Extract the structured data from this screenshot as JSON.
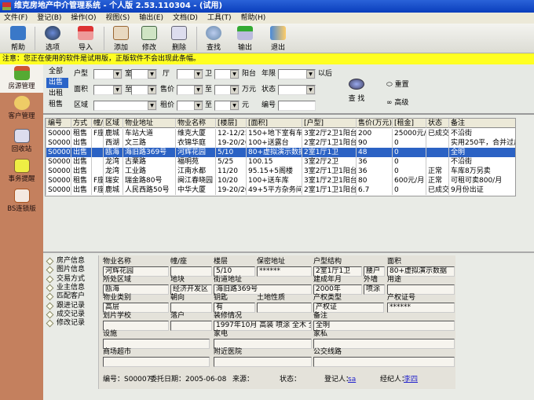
{
  "title": "维克房地产中介管理系统 - 个人版 2.53.110304 - (试用)",
  "menu": [
    "文件(F)",
    "登记(B)",
    "操作(O)",
    "视图(S)",
    "输出(E)",
    "文档(D)",
    "工具(T)",
    "帮助(H)"
  ],
  "toolbar": [
    "帮助",
    "选项",
    "导入",
    "添加",
    "修改",
    "删除",
    "查找",
    "输出",
    "退出"
  ],
  "notice": "注意：您正在使用的软件是试用版，正版软件不会出现此条幅。",
  "sidebar": [
    "房源管理",
    "客户管理",
    "回收站",
    "事务提醒",
    "BS连锁版"
  ],
  "filter": {
    "tabs": [
      "全部",
      "出售",
      "出租",
      "租售"
    ],
    "labels": {
      "huxing": "户型",
      "shi": "室",
      "ting": "厅",
      "wei": "卫",
      "yangtai": "阳台",
      "nianxian": "年限",
      "yihou": "以后",
      "mianji": "面积",
      "zhi": "至",
      "shoujia": "售价",
      "wanyuan": "万元",
      "zhuangtai": "状态",
      "quyu": "区域",
      "zujia": "租价",
      "yuan": "元",
      "bianhao": "编号"
    },
    "search": "查 找",
    "reset": "重置",
    "advanced": "高级"
  },
  "table": {
    "headers": [
      "编号",
      "方式",
      "幢/",
      "区域",
      "物业地址",
      "物业名称",
      "[楼层]",
      "[面积]",
      "[户型]",
      "售价(万元)",
      "[租金]",
      "状态",
      "备注"
    ],
    "rows": [
      [
        "S00009",
        "租售",
        "F座",
        "鹿城",
        "车站大道",
        "维克大厦",
        "12-12/25",
        "150+地下室有车位",
        "3室2厅2卫1阳台",
        "200",
        "25000元/月",
        "已成交",
        "不沿街"
      ],
      [
        "S00008",
        "出售",
        "",
        "西湖",
        "文三路",
        "衣锦华庭",
        "19-20/20",
        "100+送露台",
        "2室2厅1卫1阳台",
        "90",
        "0",
        "",
        "实用250平，合并过户"
      ],
      [
        "S00007",
        "出售",
        "",
        "瓯海",
        "海旧路369号",
        "河辉花园",
        "5/10",
        "80+虚拟演示数据",
        "2室1厅1卫",
        "48",
        "0",
        "",
        "全明"
      ],
      [
        "S00001",
        "出售",
        "",
        "龙湾",
        "古栗路",
        "福明苑",
        "5/25",
        "100.15",
        "3室2厅2卫",
        "36",
        "0",
        "",
        "不沿街"
      ],
      [
        "S00005",
        "出售",
        "",
        "龙湾",
        "工业路",
        "江南水都",
        "11/20",
        "95.15+5阁楼",
        "3室2厅1卫1阳台",
        "36",
        "0",
        "正常",
        "车库8万另卖"
      ],
      [
        "S00004",
        "租售",
        "F座",
        "瑞安",
        "瑞金路80号",
        "闽江春晓园",
        "10/20",
        "100+送车库",
        "3室1厅2卫1阳台",
        "80",
        "600元/月",
        "正常",
        "可租可卖800/月"
      ],
      [
        "S00003",
        "出售",
        "F座",
        "鹿城",
        "人民西路50号",
        "中华大厦",
        "19-20/20",
        "49+5平方杂务间",
        "2室1厅1卫1阳台",
        "6.7",
        "0",
        "已成交",
        "9月份出证"
      ]
    ],
    "selected_index": 2
  },
  "tree": [
    "房产信息",
    "图片信息",
    "交易方式",
    "业主信息",
    "匹配客户",
    "跟进记录",
    "成交记录",
    "修改记录"
  ],
  "form": {
    "wuye_mingcheng": {
      "label": "物业名称",
      "value": "河辉花园"
    },
    "zhuang": {
      "label": "幢/座",
      "value": ""
    },
    "louceng": {
      "label": "楼层",
      "value": "5/10"
    },
    "baomi": {
      "label": "保密地址",
      "value": "******"
    },
    "huxing": {
      "label": "户型结构",
      "value": "2室1厅1卫"
    },
    "yaohu": {
      "value": "腰户"
    },
    "mianji": {
      "label": "面积",
      "value": "80+虚拟演示数据"
    },
    "quyu": {
      "label": "所处区域",
      "value": "瓯海"
    },
    "dikuai": {
      "label": "地块",
      "value": "经济开发区"
    },
    "jiedao": {
      "label": "街道地址",
      "value": "海旧路369号"
    },
    "jiancheng": {
      "label": "建成年月",
      "value": "2000年"
    },
    "waiqiang": {
      "label": "外墙",
      "value": "喷涂"
    },
    "yongtu": {
      "label": "用途",
      "value": ""
    },
    "leibie": {
      "label": "物业类别",
      "value": "高层"
    },
    "chaoxiang": {
      "label": "朝向",
      "value": ""
    },
    "yaoshi": {
      "label": "钥匙",
      "value": "有"
    },
    "tudi": {
      "label": "土地性质",
      "value": ""
    },
    "chanquan": {
      "label": "产权类型",
      "value": "产权证"
    },
    "zhenghao": {
      "label": "产权证号",
      "value": "******"
    },
    "xuexiao": {
      "label": "划片学校",
      "value": ""
    },
    "luohu": {
      "label": "落户",
      "value": ""
    },
    "zhuangxiu": {
      "label": "装修情况",
      "value": "1997年10月 高装 喷涂 全木 全才"
    },
    "beizhu": {
      "label": "备注",
      "value": "全明"
    },
    "sheshi": {
      "label": "设施",
      "value": ""
    },
    "jiadian": {
      "label": "家电",
      "value": ""
    },
    "jiasi": {
      "label": "家私",
      "value": ""
    },
    "shangchang": {
      "label": "商场超市",
      "value": ""
    },
    "yiyuan": {
      "label": "附近医院",
      "value": ""
    },
    "gongjiao": {
      "label": "公交线路",
      "value": ""
    }
  },
  "status": {
    "bianhao": "编号：S00007",
    "weituo": "委托日期：2005-06-08",
    "laiyuan": "来源：",
    "zhuangtai": "状态：",
    "dengji_label": "登记人：",
    "dengji": "sa",
    "jingji_label": "经纪人：",
    "jingji": "李四"
  }
}
